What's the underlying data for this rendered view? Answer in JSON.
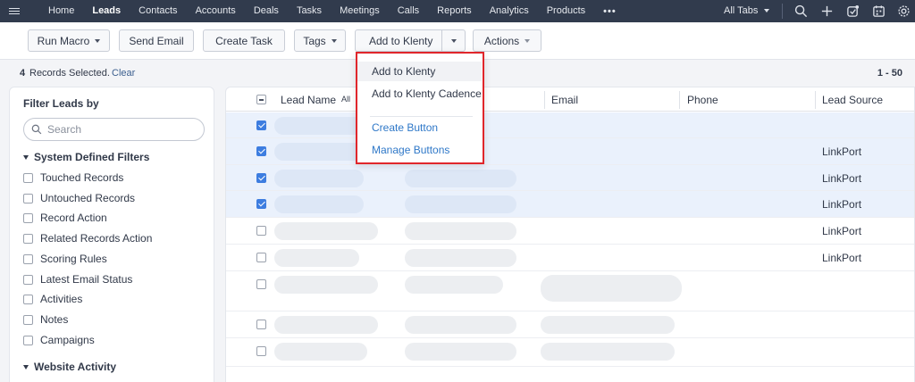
{
  "nav": {
    "tabs": [
      "Home",
      "Leads",
      "Contacts",
      "Accounts",
      "Deals",
      "Tasks",
      "Meetings",
      "Calls",
      "Reports",
      "Analytics",
      "Products"
    ],
    "more": "•••",
    "all_tabs": "All Tabs"
  },
  "toolbar": {
    "run_macro": "Run Macro",
    "send_email": "Send Email",
    "create_task": "Create Task",
    "tags": "Tags",
    "add_to_klenty": "Add to Klenty",
    "actions": "Actions"
  },
  "records": {
    "count": "4",
    "selected_text": "Records Selected.",
    "clear": "Clear",
    "range": "1 - 50"
  },
  "sidebar": {
    "title": "Filter Leads by",
    "search_placeholder": "Search",
    "section1": "System Defined Filters",
    "filters": [
      "Touched Records",
      "Untouched Records",
      "Record Action",
      "Related Records Action",
      "Scoring Rules",
      "Latest Email Status",
      "Activities",
      "Notes",
      "Campaigns"
    ],
    "section2": "Website Activity"
  },
  "table": {
    "headers": {
      "lead_name": "Lead Name",
      "all": "All",
      "email": "Email",
      "phone": "Phone",
      "lead_source": "Lead Source"
    },
    "rows": [
      {
        "checked": true,
        "source": ""
      },
      {
        "checked": true,
        "source": "LinkPort"
      },
      {
        "checked": true,
        "source": "LinkPort"
      },
      {
        "checked": true,
        "source": "LinkPort"
      },
      {
        "checked": false,
        "source": "LinkPort"
      },
      {
        "checked": false,
        "source": "LinkPort"
      },
      {
        "checked": false,
        "source": ""
      },
      {
        "checked": false,
        "source": ""
      },
      {
        "checked": false,
        "source": ""
      }
    ]
  },
  "dropdown": {
    "items": [
      "Add to Klenty",
      "Add to Klenty Cadence",
      "Create Button",
      "Manage Buttons"
    ]
  },
  "colors": {
    "nav_bg": "#313b4d",
    "accent": "#3d7de0",
    "highlight_border": "#e0262b",
    "link": "#2f78c8"
  }
}
